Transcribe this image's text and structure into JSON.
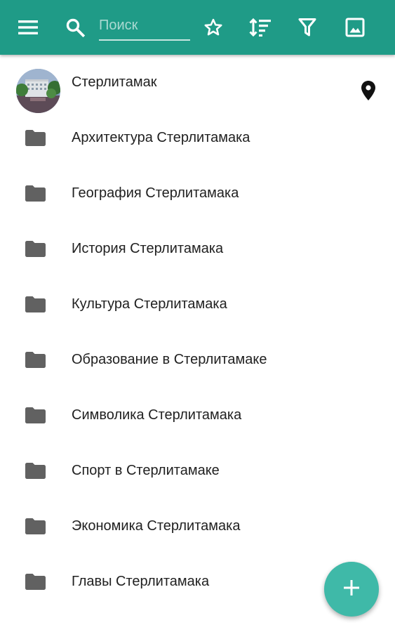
{
  "toolbar": {
    "color": "#1f9b87",
    "menu_icon": "menu-icon",
    "search_icon": "search-icon",
    "search_placeholder": "Поиск",
    "search_value": "",
    "actions": [
      "star-icon",
      "sort-icon",
      "filter-icon",
      "image-icon"
    ]
  },
  "header_item": {
    "label": "Стерлитамак",
    "avatar": "city-photo-avatar",
    "action_icon": "location-pin-icon"
  },
  "folders": [
    {
      "label": "Архитектура Стерлитамака"
    },
    {
      "label": "География Стерлитамака"
    },
    {
      "label": "История Стерлитамака"
    },
    {
      "label": "Культура Стерлитамака"
    },
    {
      "label": "Образование в Стерлитамаке"
    },
    {
      "label": "Символика Стерлитамака"
    },
    {
      "label": "Спорт в Стерлитамаке"
    },
    {
      "label": "Экономика Стерлитамака"
    },
    {
      "label": "Главы Стерлитамака"
    }
  ],
  "fab": {
    "icon": "add-icon",
    "color": "#3fb9a8"
  },
  "colors": {
    "text": "#212121",
    "folder_icon": "#616161"
  }
}
